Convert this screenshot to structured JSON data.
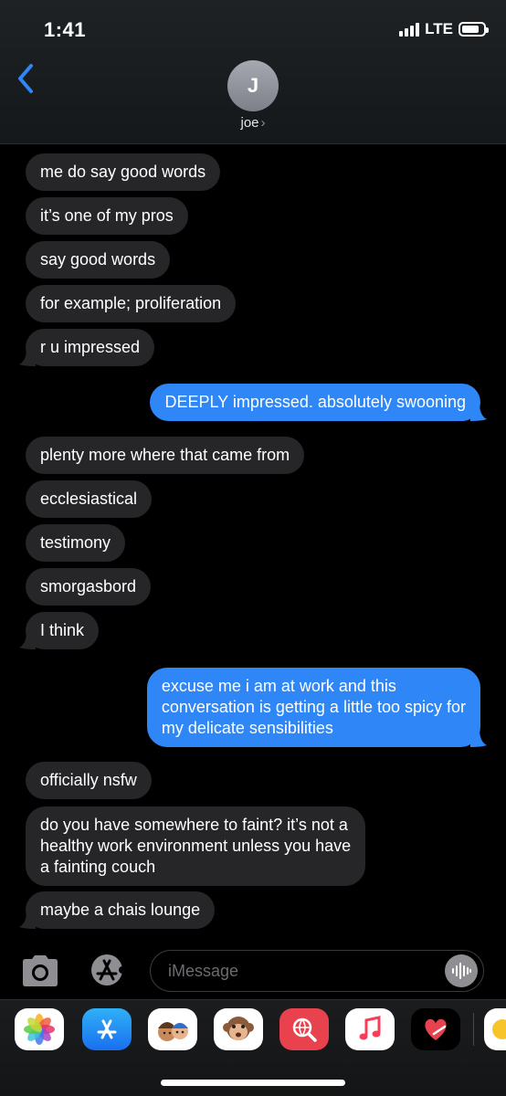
{
  "status_bar": {
    "time": "1:41",
    "network": "LTE",
    "battery_level": 0.8
  },
  "header": {
    "avatar_initial": "J",
    "contact_name": "joe",
    "chevron": "›"
  },
  "messages": [
    {
      "dir": "in",
      "text": "me do say good words"
    },
    {
      "dir": "in",
      "text": "it’s one of my pros"
    },
    {
      "dir": "in",
      "text": "say good words"
    },
    {
      "dir": "in",
      "text": "for example; proliferation"
    },
    {
      "dir": "in",
      "text": "r u impressed",
      "tail": true
    },
    {
      "dir": "out",
      "text": "DEEPLY impressed. absolutely swooning",
      "tail": true
    },
    {
      "dir": "in",
      "text": "plenty more where that came from"
    },
    {
      "dir": "in",
      "text": "ecclesiastical"
    },
    {
      "dir": "in",
      "text": "testimony"
    },
    {
      "dir": "in",
      "text": "smorgasbord"
    },
    {
      "dir": "in",
      "text": "I think",
      "tail": true
    },
    {
      "dir": "out",
      "text": "excuse me i am at work and this\nconversation is getting a little too spicy for\nmy delicate sensibilities",
      "tail": true
    },
    {
      "dir": "in",
      "text": "officially nsfw"
    },
    {
      "dir": "in",
      "text": "do you have somewhere to faint? it’s not a\nhealthy work environment unless you have\na fainting couch"
    },
    {
      "dir": "in",
      "text": "maybe a chais lounge",
      "tail": true
    }
  ],
  "composer": {
    "placeholder": "iMessage"
  },
  "app_drawer": [
    {
      "name": "photos",
      "icon": "photos-icon"
    },
    {
      "name": "app-store",
      "icon": "app-store-icon"
    },
    {
      "name": "memoji",
      "icon": "memoji-icon"
    },
    {
      "name": "animoji",
      "icon": "monkey-icon"
    },
    {
      "name": "search-images",
      "icon": "globe-search-icon"
    },
    {
      "name": "music",
      "icon": "music-note-icon"
    },
    {
      "name": "digital-touch",
      "icon": "heart-icon"
    }
  ],
  "colors": {
    "incoming": "#262628",
    "outgoing": "#2f86f6",
    "accent": "#2f86f6"
  }
}
